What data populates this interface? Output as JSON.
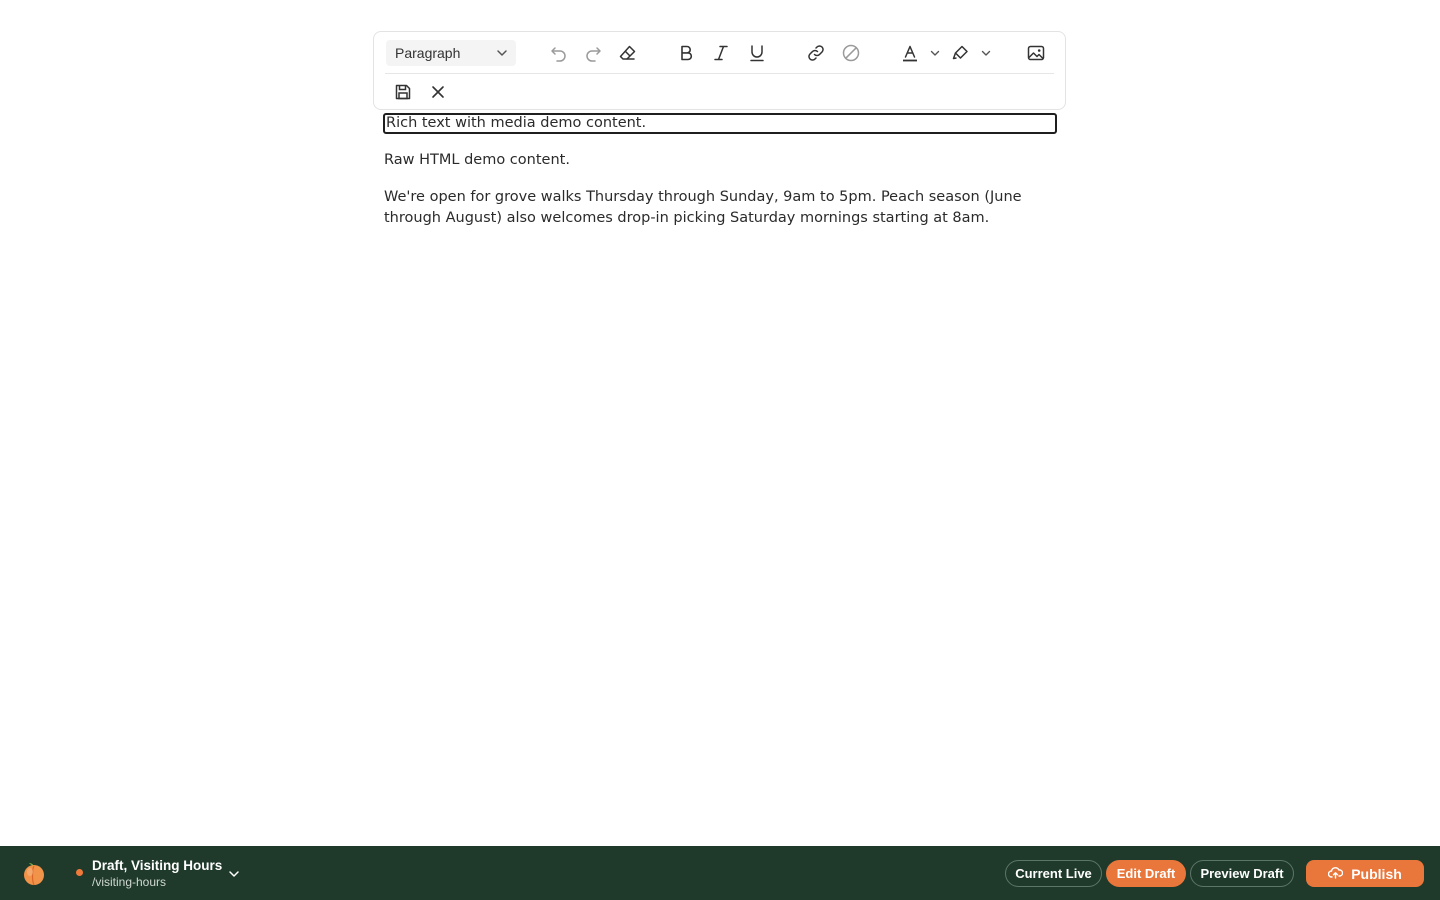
{
  "toolbar": {
    "block_type": "Paragraph",
    "icons": [
      "undo-icon",
      "redo-icon",
      "eraser-icon",
      "bold-icon",
      "italic-icon",
      "underline-icon",
      "link-icon",
      "unlink-icon",
      "text-color-icon",
      "highlight-icon",
      "image-icon",
      "save-icon",
      "close-icon"
    ]
  },
  "content": {
    "rich_block": "Rich text with media demo content.",
    "raw_block": "Raw HTML demo content.",
    "body_text": "We're open for grove walks Thursday through Sunday, 9am to 5pm. Peach season (June through August) also welcomes drop-in picking Saturday mornings starting at 8am."
  },
  "bottom_bar": {
    "page_title": "Draft, Visiting Hours",
    "page_path": "/visiting-hours",
    "buttons": {
      "current_live": "Current Live",
      "edit_draft": "Edit Draft",
      "preview_draft": "Preview Draft",
      "publish": "Publish"
    },
    "colors": {
      "bar_bg": "#1f3a2b",
      "accent": "#e9763a"
    }
  }
}
